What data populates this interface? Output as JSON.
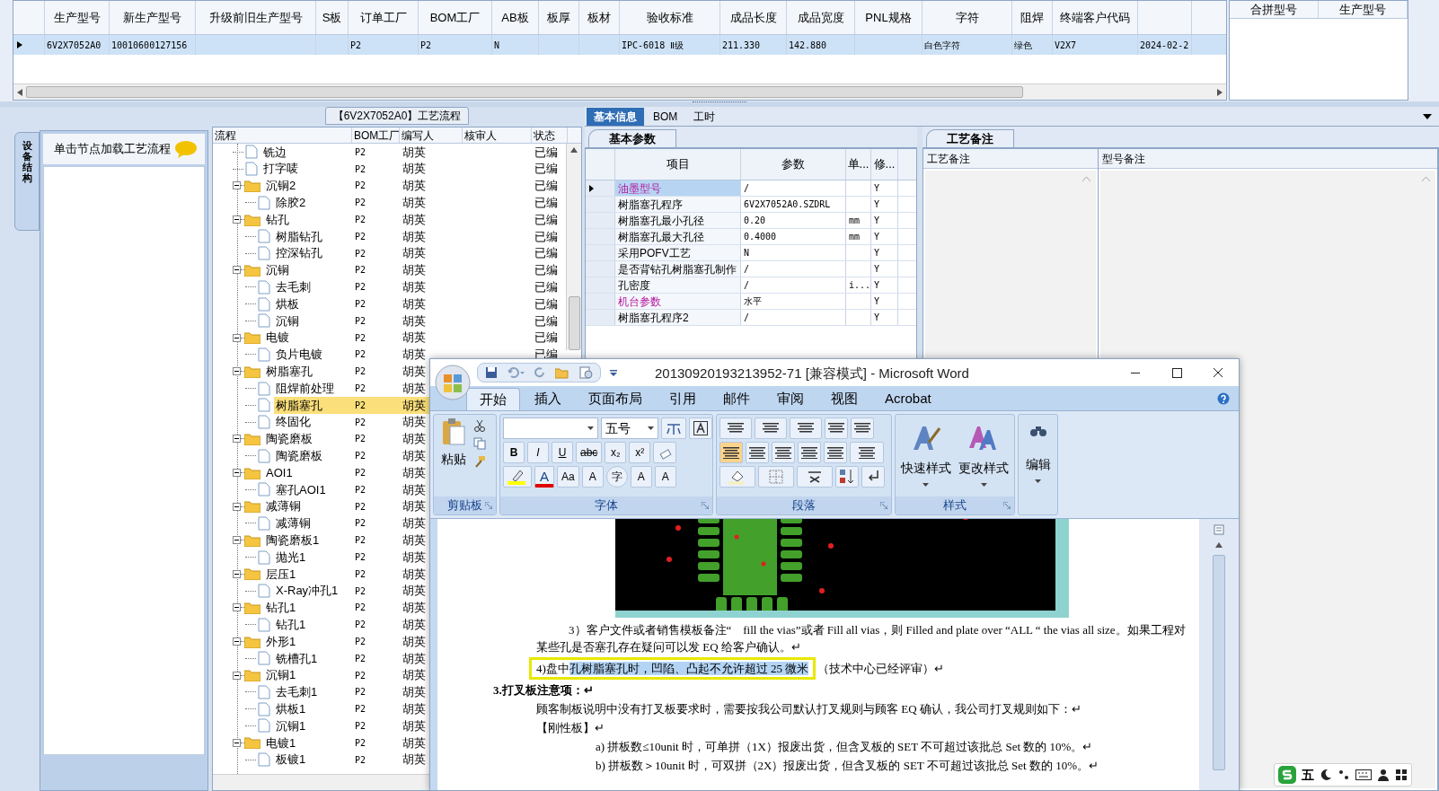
{
  "product_grid": {
    "columns": [
      "生产型号",
      "新生产型号",
      "升级前旧生产型号",
      "S板",
      "订单工厂",
      "BOM工厂",
      "AB板",
      "板厚",
      "板材",
      "验收标准",
      "成品长度",
      "成品宽度",
      "PNL规格",
      "字符",
      "阻焊",
      "终端客户代码"
    ],
    "rows": [
      {
        "selected": true,
        "cells": [
          "6V2X7052A0",
          "10010600127156",
          null,
          null,
          "P2",
          "P2",
          "N",
          null,
          null,
          "IPC-6018 Ⅱ级",
          "211.330",
          "142.880",
          null,
          "白色字符",
          "绿色",
          "V2X7",
          "2024-02-2"
        ]
      }
    ]
  },
  "merge_panel": {
    "columns": [
      "合拼型号",
      "生产型号"
    ]
  },
  "side_panel": {
    "vertical_tab": "设备结构",
    "hint": "单击节点加载工艺流程"
  },
  "process_tree": {
    "title": "【6V2X7052A0】工艺流程",
    "columns": [
      "流程",
      "BOM工厂",
      "编写人",
      "核审人",
      "状态"
    ],
    "nodes": [
      {
        "kind": "group",
        "children": [
          {
            "kind": "step",
            "label": "铣边",
            "bom_factory": "P2",
            "writer": "胡英",
            "status": "已编",
            "selected": false
          },
          {
            "kind": "step",
            "label": "打字唛",
            "bom_factory": "P2",
            "writer": "胡英",
            "status": "已编",
            "selected": false
          }
        ]
      },
      {
        "kind": "folder",
        "label": "沉铜2",
        "bom_factory": "P2",
        "writer": "胡英",
        "status": "已编",
        "selected": false,
        "expanded": true,
        "children": [
          {
            "kind": "step",
            "label": "除胶2",
            "bom_factory": "P2",
            "writer": "胡英",
            "status": "已编",
            "selected": false
          }
        ]
      },
      {
        "kind": "folder",
        "label": "钻孔",
        "bom_factory": "P2",
        "writer": "胡英",
        "status": "已编",
        "selected": false,
        "expanded": true,
        "children": [
          {
            "kind": "step",
            "label": "树脂钻孔",
            "bom_factory": "P2",
            "writer": "胡英",
            "status": "已编",
            "selected": false
          },
          {
            "kind": "step",
            "label": "控深钻孔",
            "bom_factory": "P2",
            "writer": "胡英",
            "status": "已编",
            "selected": false
          }
        ]
      },
      {
        "kind": "folder",
        "label": "沉铜",
        "bom_factory": "P2",
        "writer": "胡英",
        "status": "已编",
        "selected": false,
        "expanded": true,
        "children": [
          {
            "kind": "step",
            "label": "去毛刺",
            "bom_factory": "P2",
            "writer": "胡英",
            "status": "已编",
            "selected": false
          },
          {
            "kind": "step",
            "label": "烘板",
            "bom_factory": "P2",
            "writer": "胡英",
            "status": "已编",
            "selected": false
          },
          {
            "kind": "step",
            "label": "沉铜",
            "bom_factory": "P2",
            "writer": "胡英",
            "status": "已编",
            "selected": false
          }
        ]
      },
      {
        "kind": "folder",
        "label": "电镀",
        "bom_factory": "P2",
        "writer": "胡英",
        "status": "已编",
        "selected": false,
        "expanded": true,
        "children": [
          {
            "kind": "step",
            "label": "负片电镀",
            "bom_factory": "P2",
            "writer": "胡英",
            "status": "已编",
            "selected": false
          }
        ]
      },
      {
        "kind": "folder",
        "label": "树脂塞孔",
        "bom_factory": "P2",
        "writer": "胡英",
        "selected": false,
        "expanded": true,
        "children": [
          {
            "kind": "step",
            "label": "阻焊前处理",
            "bom_factory": "P2",
            "writer": "胡英",
            "selected": false
          },
          {
            "kind": "step",
            "label": "树脂塞孔",
            "bom_factory": "P2",
            "writer": "胡英",
            "selected": true
          },
          {
            "kind": "step",
            "label": "终固化",
            "bom_factory": "P2",
            "writer": "胡英",
            "selected": false
          }
        ]
      },
      {
        "kind": "folder",
        "label": "陶瓷磨板",
        "bom_factory": "P2",
        "writer": "胡英",
        "selected": false,
        "expanded": true,
        "children": [
          {
            "kind": "step",
            "label": "陶瓷磨板",
            "bom_factory": "P2",
            "writer": "胡英",
            "selected": false
          }
        ]
      },
      {
        "kind": "folder",
        "label": "AOI1",
        "bom_factory": "P2",
        "writer": "胡英",
        "selected": false,
        "expanded": true,
        "children": [
          {
            "kind": "step",
            "label": "塞孔AOI1",
            "bom_factory": "P2",
            "writer": "胡英",
            "selected": false
          }
        ]
      },
      {
        "kind": "folder",
        "label": "减薄铜",
        "bom_factory": "P2",
        "writer": "胡英",
        "selected": false,
        "expanded": true,
        "children": [
          {
            "kind": "step",
            "label": "减薄铜",
            "bom_factory": "P2",
            "writer": "胡英",
            "selected": false
          }
        ]
      },
      {
        "kind": "folder",
        "label": "陶瓷磨板1",
        "bom_factory": "P2",
        "writer": "胡英",
        "selected": false,
        "expanded": true,
        "children": [
          {
            "kind": "step",
            "label": "抛光1",
            "bom_factory": "P2",
            "writer": "胡英",
            "selected": false
          }
        ]
      },
      {
        "kind": "folder",
        "label": "层压1",
        "bom_factory": "P2",
        "writer": "胡英",
        "selected": false,
        "expanded": true,
        "children": [
          {
            "kind": "step",
            "label": "X-Ray冲孔1",
            "bom_factory": "P2",
            "writer": "胡英",
            "selected": false
          }
        ]
      },
      {
        "kind": "folder",
        "label": "钻孔1",
        "bom_factory": "P2",
        "writer": "胡英",
        "selected": false,
        "expanded": true,
        "children": [
          {
            "kind": "step",
            "label": "钻孔1",
            "bom_factory": "P2",
            "writer": "胡英",
            "selected": false
          }
        ]
      },
      {
        "kind": "folder",
        "label": "外形1",
        "bom_factory": "P2",
        "writer": "胡英",
        "selected": false,
        "expanded": true,
        "children": [
          {
            "kind": "step",
            "label": "铣槽孔1",
            "bom_factory": "P2",
            "writer": "胡英",
            "selected": false
          }
        ]
      },
      {
        "kind": "folder",
        "label": "沉铜1",
        "bom_factory": "P2",
        "writer": "胡英",
        "selected": false,
        "expanded": true,
        "children": [
          {
            "kind": "step",
            "label": "去毛刺1",
            "bom_factory": "P2",
            "writer": "胡英",
            "selected": false
          },
          {
            "kind": "step",
            "label": "烘板1",
            "bom_factory": "P2",
            "writer": "胡英",
            "selected": false
          },
          {
            "kind": "step",
            "label": "沉铜1",
            "bom_factory": "P2",
            "writer": "胡英",
            "selected": false
          }
        ]
      },
      {
        "kind": "folder",
        "label": "电镀1",
        "bom_factory": "P2",
        "writer": "胡英",
        "selected": false,
        "expanded": true,
        "children": [
          {
            "kind": "step",
            "label": "板镀1",
            "bom_factory": "P2",
            "writer": "胡英",
            "selected": false
          }
        ]
      }
    ]
  },
  "detail_tabs": [
    {
      "label": "基本信息",
      "selected": true
    },
    {
      "label": "BOM",
      "selected": false
    },
    {
      "label": "工时",
      "selected": false
    }
  ],
  "params_panel": {
    "tab": "基本参数",
    "columns": [
      "项目",
      "参数",
      "单...",
      "修..."
    ],
    "rows": [
      {
        "kind": "group",
        "item": "油墨型号",
        "value": "/",
        "modified": "Y",
        "selected": true
      },
      {
        "kind": "param",
        "item": "树脂塞孔程序",
        "value": "6V2X7052A0.SZDRL",
        "modified": "Y",
        "selected": false
      },
      {
        "kind": "param",
        "item": "树脂塞孔最小孔径",
        "value": "0.20",
        "unit": "mm",
        "modified": "Y",
        "selected": false
      },
      {
        "kind": "param",
        "item": "树脂塞孔最大孔径",
        "value": "0.4000",
        "unit": "mm",
        "modified": "Y",
        "selected": false
      },
      {
        "kind": "param",
        "item": "采用POFV工艺",
        "value": "N",
        "modified": "Y",
        "selected": false
      },
      {
        "kind": "param",
        "item": "是否背钻孔树脂塞孔制作",
        "value": "/",
        "modified": "Y",
        "selected": false
      },
      {
        "kind": "param",
        "item": "孔密度",
        "value": "/",
        "unit": "i...",
        "modified": "Y",
        "selected": false
      },
      {
        "kind": "group",
        "item": "机台参数",
        "value": "水平",
        "modified": "Y",
        "selected": false
      },
      {
        "kind": "param",
        "item": "树脂塞孔程序2",
        "value": "/",
        "modified": "Y",
        "selected": false
      }
    ]
  },
  "notes_panel": {
    "tab": "工艺备注",
    "columns": [
      "工艺备注",
      "型号备注"
    ]
  },
  "word_window": {
    "title": "20130920193213952-71 [兼容模式] - Microsoft Word",
    "ribbon_tabs": [
      {
        "label": "开始",
        "selected": true
      },
      {
        "label": "插入",
        "selected": false
      },
      {
        "label": "页面布局",
        "selected": false
      },
      {
        "label": "引用",
        "selected": false
      },
      {
        "label": "邮件",
        "selected": false
      },
      {
        "label": "审阅",
        "selected": false
      },
      {
        "label": "视图",
        "selected": false
      },
      {
        "label": "Acrobat",
        "selected": false
      }
    ],
    "paste": "粘贴",
    "font_size": "五号",
    "font_buttons": [
      "B",
      "I",
      "U",
      "abc",
      "x₂",
      "x²"
    ],
    "font_buttons_2": [
      "Aa",
      "A",
      "字",
      "A",
      "A"
    ],
    "font_color": "A",
    "styles": [
      "快速样式",
      "更改样式"
    ],
    "edit": "编辑",
    "groups": [
      "剪贴板",
      "字体",
      "段落",
      "样式"
    ],
    "paragraphs": [
      {
        "kind": "indented",
        "segments": [
          {
            "text": "3）客户文件或者销售模板备注“　fill the vias”或者 Fill all vias，则  Filled and plate over “ALL “  the vias all size。如果工程对某些孔是否塞孔存在疑问可以发 EQ 给客户确认。↵",
            "selected": false,
            "framed": false
          }
        ]
      },
      {
        "kind": "indented",
        "segments": [
          {
            "text": "4)盘中",
            "selected": false,
            "framed": true
          },
          {
            "text": "孔树脂塞孔时，凹陷、凸起不允许超过 25 微米",
            "selected": true,
            "framed": true
          },
          {
            "text": "（技术中心已经评审）↵",
            "selected": false,
            "framed": false
          }
        ]
      },
      {
        "kind": "heading",
        "segments": [
          {
            "text": "3.打叉板注意项：↵",
            "selected": false,
            "framed": false
          }
        ]
      },
      {
        "kind": "indented",
        "segments": [
          {
            "text": "顾客制板说明中没有打叉板要求时，需要按我公司默认打叉规则与顾客 EQ 确认，我公司打叉规则如下：↵",
            "selected": false,
            "framed": false
          }
        ]
      },
      {
        "kind": "indented",
        "segments": [
          {
            "text": "【刚性板】↵",
            "selected": false,
            "framed": false
          }
        ]
      },
      {
        "kind": "list",
        "segments": [
          {
            "text": "a) 拼板数≤10unit 时，可单拼（1X）报废出货，但含叉板的 SET 不可超过该批总 Set 数的 10%。↵",
            "selected": false,
            "framed": false
          }
        ]
      },
      {
        "kind": "list",
        "segments": [
          {
            "text": "b) 拼板数＞10unit 时，可双拼（2X）报废出货，但含叉板的 SET 不可超过该批总 Set 数的 10%。↵",
            "selected": false,
            "framed": false
          }
        ]
      }
    ]
  },
  "ime_bar": {
    "mode": "五"
  }
}
